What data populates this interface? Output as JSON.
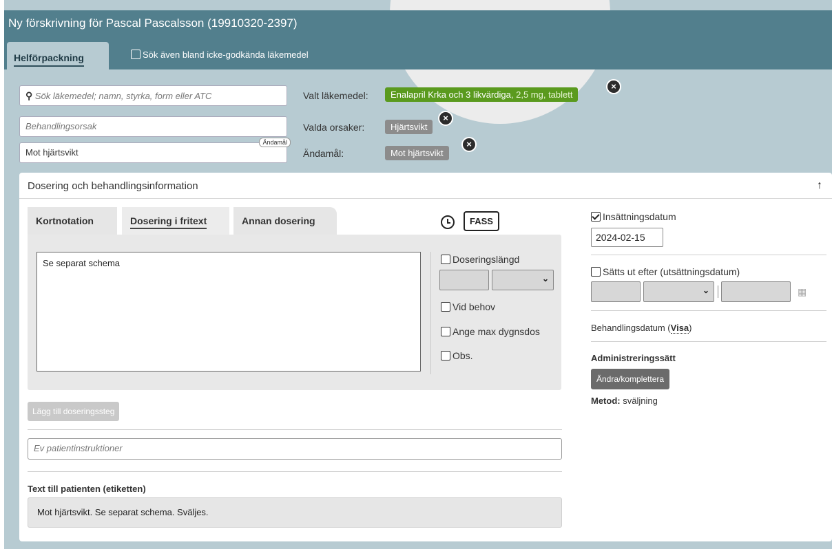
{
  "header": {
    "title": "Ny förskrivning för Pascal Pascalsson (19910320-2397)",
    "tab_label": "Helförpackning",
    "search_nonapproved_label": "Sök även bland icke-godkända läkemedel"
  },
  "prescription": {
    "search_placeholder": "Sök läkemedel; namn, styrka, form eller ATC",
    "treatment_reason_placeholder": "Behandlingsorsak",
    "purpose_value": "Mot hjärtsvikt",
    "purpose_tag": "Ändamål",
    "selected_drug_label": "Valt läkemedel:",
    "selected_drug_name": "Enalapril Krka och 3 likvärdiga,",
    "selected_drug_detail": " 2,5 mg, tablett",
    "selected_reasons_label": "Valda orsaker:",
    "selected_reason": "Hjärtsvikt",
    "purpose_label": "Ändamål:",
    "purpose_chip": "Mot hjärtsvikt",
    "remove_symbol": "×"
  },
  "dosing": {
    "panel_title": "Dosering och behandlingsinformation",
    "collapse_symbol": "↑",
    "tabs": [
      "Kortnotation",
      "Dosering i fritext",
      "Annan dosering"
    ],
    "fass_label": "FASS",
    "free_text_value": "Se separat schema",
    "options": {
      "duration": "Doseringslängd",
      "as_needed": "Vid behov",
      "max_daily": "Ange max dygnsdos",
      "obs": "Obs."
    },
    "add_step_label": "Lägg till doseringssteg",
    "patient_instructions_placeholder": "Ev patientinstruktioner",
    "label_title": "Text till patienten (etiketten)",
    "label_text": "Mot hjärtsvikt. Se separat schema. Sväljes."
  },
  "treatment": {
    "start_label": "Insättningsdatum",
    "start_date": "2024-02-15",
    "stop_label": "Sätts ut efter (utsättningsdatum)",
    "treatment_dates_label": "Behandlingsdatum (",
    "treatment_dates_link": "Visa",
    "treatment_dates_close": ")",
    "administration_title": "Administreringssätt",
    "change_button": "Ändra/komplettera",
    "method_label": "Metod:",
    "method_value": " sväljning"
  },
  "colors": {
    "header": "#527f8d",
    "background": "#b7cbd2",
    "drug_chip": "#5a9a1e",
    "reason_chip": "#8c8c8c"
  }
}
